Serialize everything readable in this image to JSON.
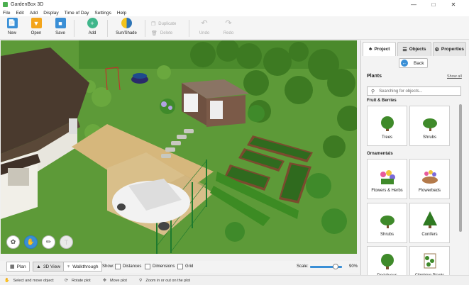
{
  "window": {
    "title": "GardenBox 3D"
  },
  "menu": [
    "File",
    "Edit",
    "Add",
    "Display",
    "Time of Day",
    "Settings",
    "Help"
  ],
  "toolbar": {
    "new": "New",
    "open": "Open",
    "save": "Save",
    "add": "Add",
    "sun_shade": "Sun/Shade",
    "duplicate": "Duplicate",
    "delete": "Delete",
    "undo": "Undo",
    "redo": "Redo"
  },
  "panel": {
    "tabs": {
      "project": "Project",
      "objects": "Objects",
      "properties": "Properties"
    },
    "back": "Back",
    "section": "Plants",
    "show_all": "Show all",
    "search_placeholder": "Searching for objects...",
    "categories": {
      "fruit": "Fruit & Berries",
      "ornamentals": "Ornamentals"
    },
    "items": {
      "trees": "Trees",
      "shrubs": "Shrubs",
      "flowers": "Flowers & Herbs",
      "flowerbeds": "Flowerbeds",
      "shrubs2": "Shrubs",
      "conifers": "Conifers",
      "deciduous": "Deciduous",
      "climbing": "Climbing Plants"
    }
  },
  "viewbar": {
    "plan": "Plan",
    "view3d": "3D View",
    "walkthrough": "Walkthrough",
    "show": "Show:",
    "distances": "Distances",
    "dimensions": "Dimensions",
    "grid": "Grid",
    "scale_label": "Scale:",
    "scale_value": "90%",
    "scale_level": 0.9
  },
  "status": {
    "select": "Select and move object",
    "rotate": "Rotate plot",
    "move": "Move plot",
    "zoom": "Zoom in or out on the plot"
  },
  "colors": {
    "accent": "#3a8fd6",
    "grass": "#5d9a38"
  }
}
